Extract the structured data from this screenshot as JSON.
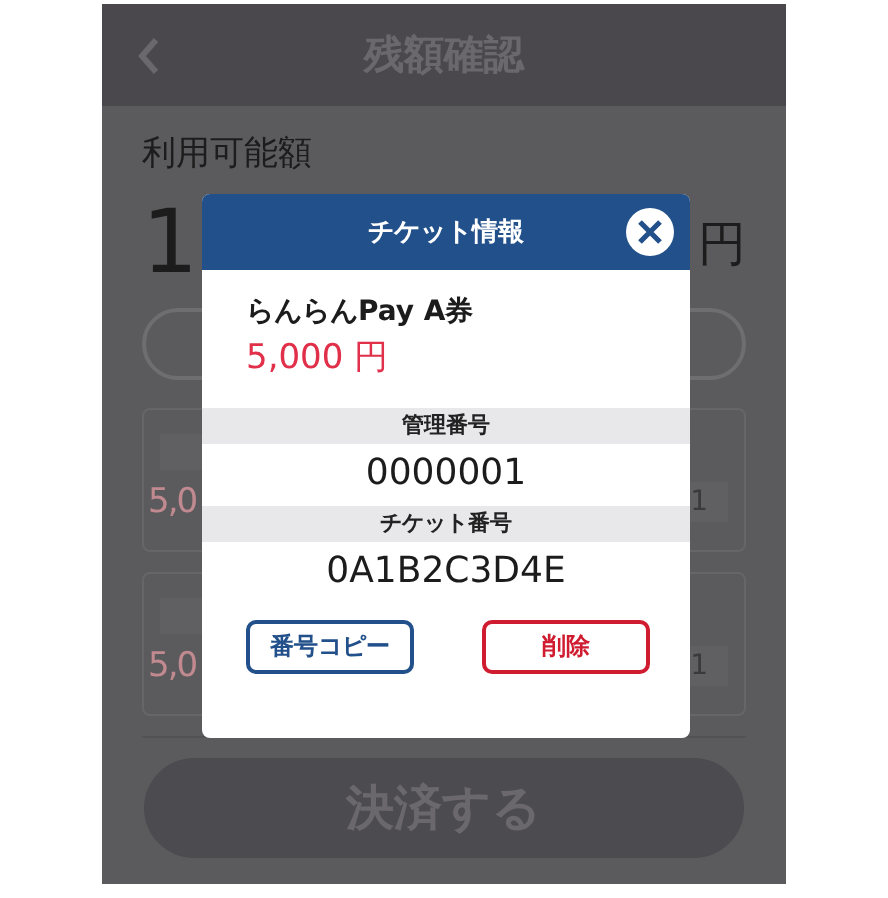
{
  "header": {
    "title": "残額確認"
  },
  "available": {
    "label": "利用可能額",
    "amount_start": "1",
    "amount_unit": "円"
  },
  "cards": [
    {
      "amount": "5,0",
      "number": "1"
    },
    {
      "amount": "5,0",
      "number": "1"
    }
  ],
  "pay_button": "決済する",
  "modal": {
    "title": "チケット情報",
    "ticket_name": "らんらんPay A券",
    "price": "5,000 円",
    "fields": [
      {
        "label": "管理番号",
        "value": "0000001"
      },
      {
        "label": "チケット番号",
        "value": "0A1B2C3D4E"
      }
    ],
    "buttons": [
      {
        "label": "番号コピー",
        "kind": "copy"
      },
      {
        "label": "削除",
        "kind": "delete"
      }
    ]
  }
}
